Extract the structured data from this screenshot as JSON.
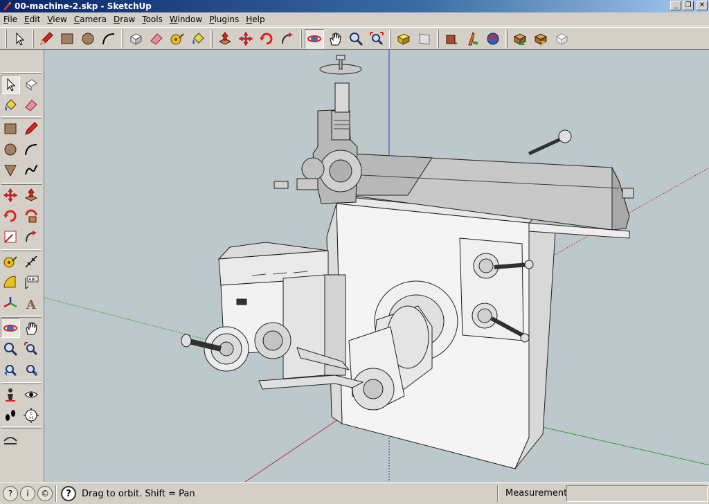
{
  "window": {
    "title": "00-machine-2.skp - SketchUp",
    "controls": {
      "minimize": "_",
      "maximize": "❐",
      "close": "✕"
    }
  },
  "menu": [
    {
      "label": "File",
      "ul": "F",
      "rest": "ile"
    },
    {
      "label": "Edit",
      "ul": "E",
      "rest": "dit"
    },
    {
      "label": "View",
      "ul": "V",
      "rest": "iew"
    },
    {
      "label": "Camera",
      "ul": "C",
      "rest": "amera"
    },
    {
      "label": "Draw",
      "ul": "D",
      "rest": "raw"
    },
    {
      "label": "Tools",
      "ul": "T",
      "rest": "ools"
    },
    {
      "label": "Window",
      "ul": "W",
      "rest": "indow"
    },
    {
      "label": "Plugins",
      "ul": "P",
      "rest": "lugins"
    },
    {
      "label": "Help",
      "ul": "H",
      "rest": "elp"
    }
  ],
  "top_toolbar": [
    "select-icon",
    "pencil-icon",
    "rectangle-icon",
    "circle-icon",
    "arc-icon",
    "make-component-icon",
    "eraser-icon",
    "tape-measure-icon",
    "paint-bucket-icon",
    "push-pull-icon",
    "move-icon",
    "rotate-icon",
    "follow-me-icon",
    "orbit-icon",
    "pan-icon",
    "zoom-icon",
    "zoom-extents-icon",
    "previous-view-icon",
    "next-view-icon",
    "get-models-icon",
    "share-component-icon",
    "share-model-icon",
    "warehouse-icon",
    "get-photo-icon",
    "upload-icon",
    "component-options-icon"
  ],
  "left_toolbar": [
    "select-icon",
    "make-component-icon",
    "paint-bucket-icon",
    "eraser-icon",
    "rectangle-icon",
    "line-icon",
    "circle-icon",
    "arc-icon",
    "polygon-icon",
    "freehand-icon",
    "move-icon",
    "push-pull-icon",
    "rotate-icon",
    "follow-me-icon",
    "scale-icon",
    "offset-icon",
    "tape-measure-icon",
    "dimension-icon",
    "protractor-icon",
    "text-icon",
    "axes-icon",
    "3d-text-icon",
    "orbit-icon",
    "pan-icon",
    "zoom-icon",
    "zoom-window-icon",
    "previous-icon",
    "zoom-extents-icon",
    "position-camera-icon",
    "look-around-icon",
    "walk-icon",
    "section-plane-icon",
    "sandbox-icon"
  ],
  "status": {
    "hint": "Drag to orbit.  Shift = Pan",
    "measurements_label": "Measurements",
    "measurements_value": "",
    "help_glyph": "?"
  },
  "colors": {
    "viewport_bg": "#bcc8cc",
    "chrome": "#d4d0c8",
    "title_start": "#0a246a",
    "title_end": "#a6caf0",
    "axis_red": "#c03030",
    "axis_green": "#30a030",
    "axis_blue": "#3030c0"
  }
}
